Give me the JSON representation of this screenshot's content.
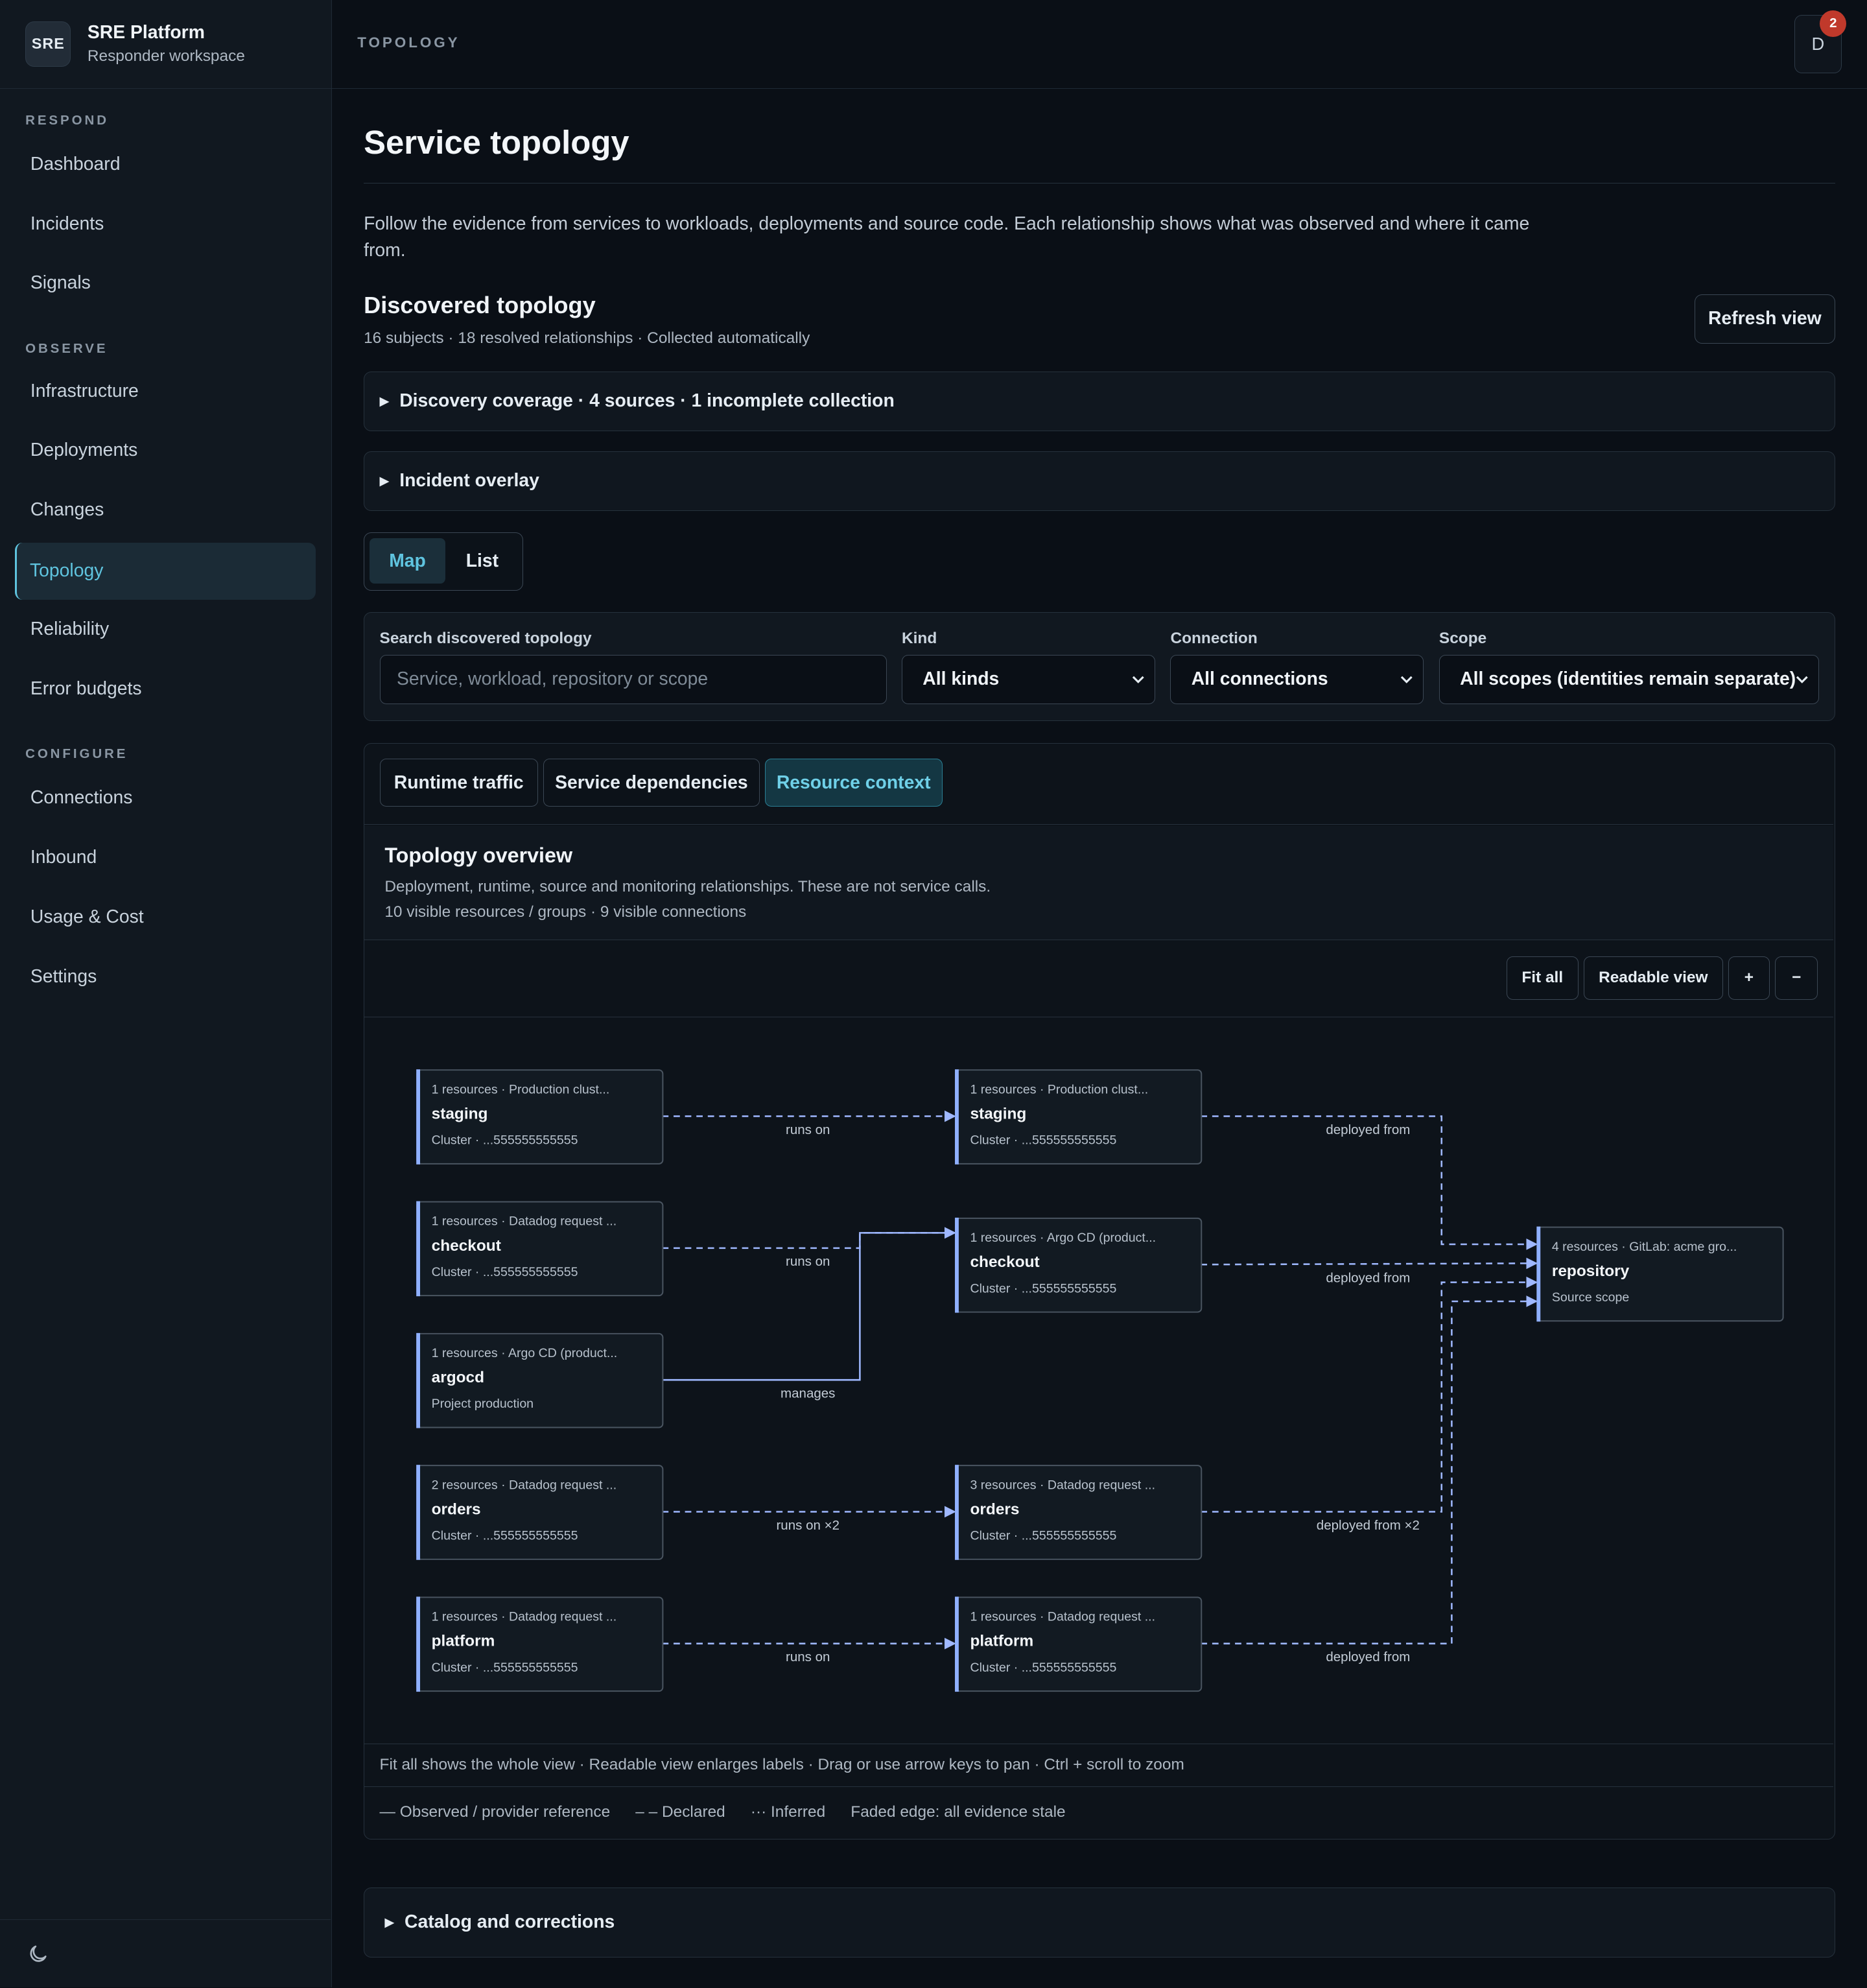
{
  "brand": {
    "logo": "SRE",
    "title": "SRE Platform",
    "subtitle": "Responder workspace"
  },
  "nav": {
    "sections": [
      {
        "label": "RESPOND"
      },
      {
        "label": "OBSERVE"
      },
      {
        "label": "CONFIGURE"
      }
    ],
    "items": [
      {
        "label": "Dashboard"
      },
      {
        "label": "Incidents"
      },
      {
        "label": "Signals"
      },
      {
        "label": "Infrastructure"
      },
      {
        "label": "Deployments"
      },
      {
        "label": "Changes"
      },
      {
        "label": "Topology",
        "active": true
      },
      {
        "label": "Reliability"
      },
      {
        "label": "Error budgets"
      },
      {
        "label": "Connections"
      },
      {
        "label": "Inbound"
      },
      {
        "label": "Usage & Cost"
      },
      {
        "label": "Settings"
      }
    ],
    "theme_icon": "moon-icon"
  },
  "header": {
    "breadcrumb": "TOPOLOGY",
    "avatar": "D",
    "notifications": "2"
  },
  "page": {
    "title": "Service topology",
    "intro": "Follow the evidence from services to workloads, deployments and source code. Each relationship shows what was observed and where it came from.",
    "section_title": "Discovered topology",
    "section_sub": "16 subjects · 18 resolved relationships · Collected automatically",
    "refresh": "Refresh view",
    "coverage": "Discovery coverage · 4 sources · 1 incomplete collection",
    "incident_overlay": "Incident overlay",
    "view_map": "Map",
    "view_list": "List",
    "catalog": "Catalog and corrections"
  },
  "filters": {
    "search_label": "Search discovered topology",
    "search_placeholder": "Service, workload, repository or scope",
    "kind_label": "Kind",
    "kind_value": "All kinds",
    "connection_label": "Connection",
    "connection_value": "All connections",
    "scope_label": "Scope",
    "scope_value": "All scopes (identities remain separate)"
  },
  "tabs": {
    "runtime": "Runtime traffic",
    "deps": "Service dependencies",
    "resource": "Resource context"
  },
  "overview": {
    "title": "Topology overview",
    "sub1": "Deployment, runtime, source and monitoring relationships. These are not service calls.",
    "sub2": "10 visible resources / groups · 9 visible connections"
  },
  "toolbar": {
    "fit": "Fit all",
    "readable": "Readable view",
    "zoom_in": "+",
    "zoom_out": "−"
  },
  "graph": {
    "nodes": [
      {
        "id": "n1",
        "meta": "1 resources · Production clust...",
        "name": "staging",
        "sub": "Cluster · ...555555555555"
      },
      {
        "id": "n2",
        "meta": "1 resources · Datadog request ...",
        "name": "checkout",
        "sub": "Cluster · ...555555555555"
      },
      {
        "id": "n3",
        "meta": "1 resources · Argo CD (product...",
        "name": "argocd",
        "sub": "Project production"
      },
      {
        "id": "n4",
        "meta": "2 resources · Datadog request ...",
        "name": "orders",
        "sub": "Cluster · ...555555555555"
      },
      {
        "id": "n5",
        "meta": "1 resources · Datadog request ...",
        "name": "platform",
        "sub": "Cluster · ...555555555555"
      },
      {
        "id": "n6",
        "meta": "1 resources · Production clust...",
        "name": "staging",
        "sub": "Cluster · ...555555555555"
      },
      {
        "id": "n7",
        "meta": "1 resources · Argo CD (product...",
        "name": "checkout",
        "sub": "Cluster · ...555555555555"
      },
      {
        "id": "n8",
        "meta": "3 resources · Datadog request ...",
        "name": "orders",
        "sub": "Cluster · ...555555555555"
      },
      {
        "id": "n9",
        "meta": "1 resources · Datadog request ...",
        "name": "platform",
        "sub": "Cluster · ...555555555555"
      },
      {
        "id": "n10",
        "meta": "4 resources · GitLab: acme gro...",
        "name": "repository",
        "sub": "Source scope"
      }
    ],
    "edges": [
      {
        "from": "n1",
        "to": "n6",
        "label": "runs on",
        "style": "declared"
      },
      {
        "from": "n2",
        "to": "n7",
        "label": "runs on",
        "style": "declared"
      },
      {
        "from": "n3",
        "to": "n7",
        "label": "manages",
        "style": "observed"
      },
      {
        "from": "n4",
        "to": "n8",
        "label": "runs on ×2",
        "style": "declared"
      },
      {
        "from": "n5",
        "to": "n9",
        "label": "runs on",
        "style": "declared"
      },
      {
        "from": "n6",
        "to": "n10",
        "label": "deployed from",
        "style": "declared"
      },
      {
        "from": "n7",
        "to": "n10",
        "label": "deployed from",
        "style": "declared"
      },
      {
        "from": "n8",
        "to": "n10",
        "label": "deployed from ×2",
        "style": "declared"
      },
      {
        "from": "n9",
        "to": "n10",
        "label": "deployed from",
        "style": "declared"
      }
    ]
  },
  "hints": "Fit all shows the whole view · Readable view enlarges labels · Drag or use arrow keys to pan · Ctrl + scroll to zoom",
  "legend": {
    "observed": "— Observed / provider reference",
    "declared": "– – Declared",
    "inferred": "··· Inferred",
    "faded": "Faded edge: all evidence stale"
  },
  "colors": {
    "accent": "#5fc4df",
    "edge": "#9fb8ff",
    "node_bar": "#8fb0ff",
    "badge": "#c0392b"
  }
}
